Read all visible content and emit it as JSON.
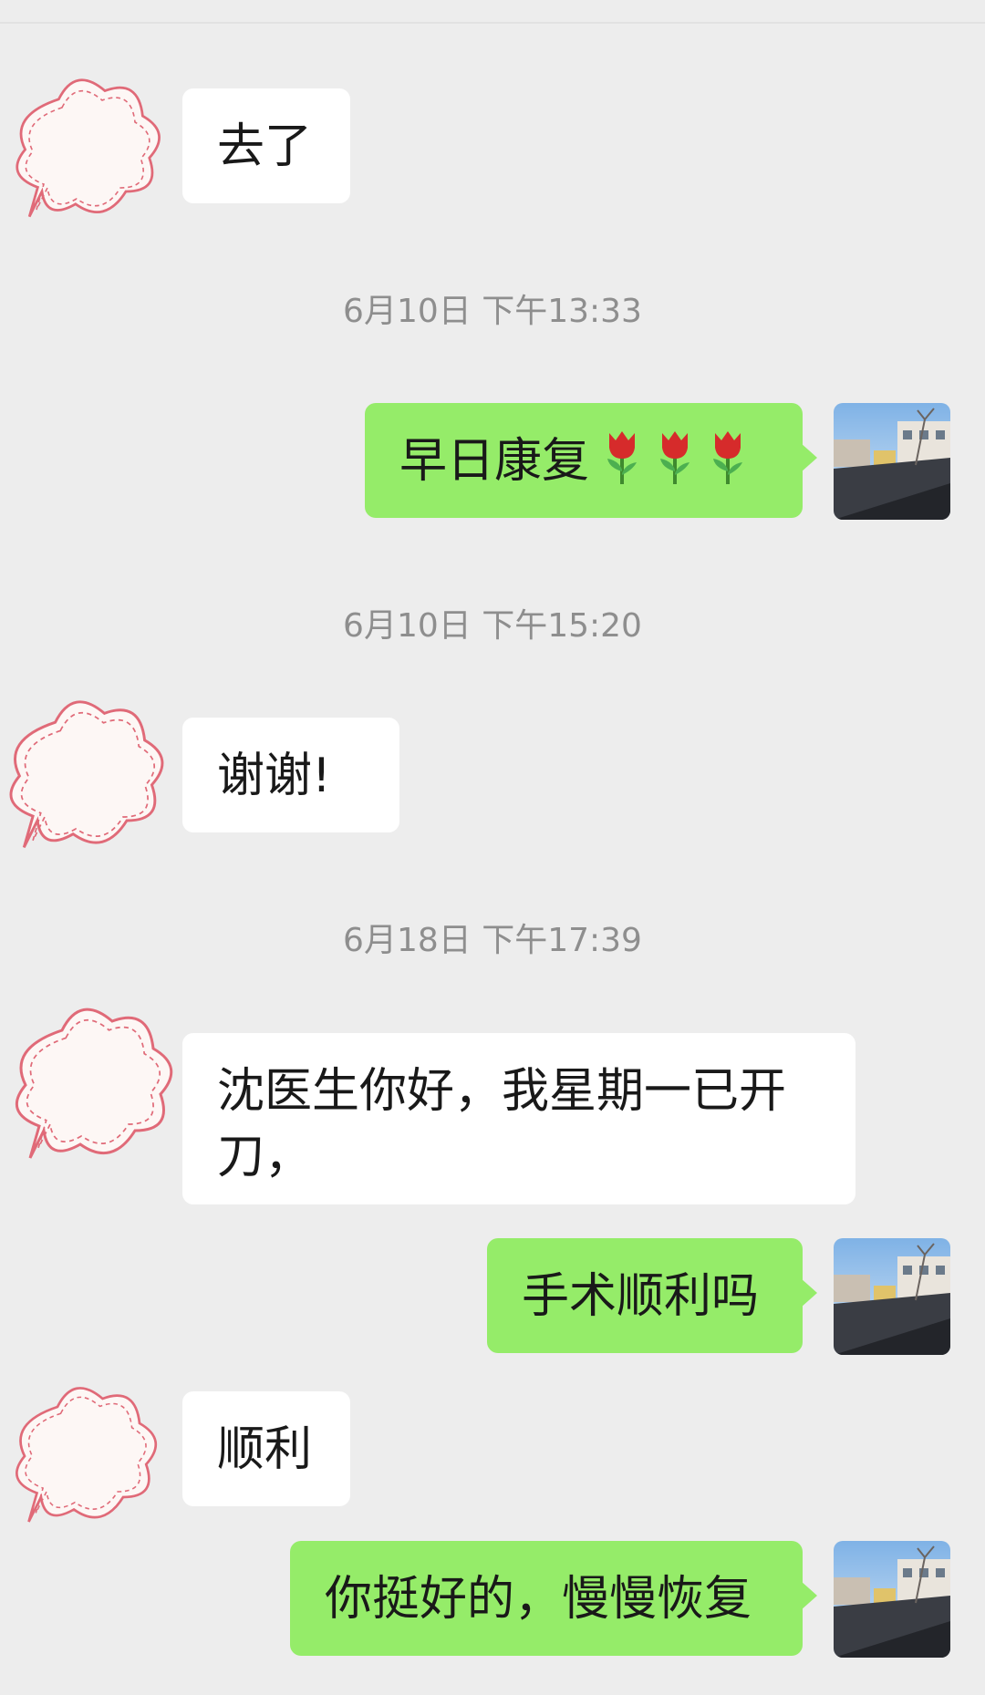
{
  "messages": [
    {
      "type": "incoming",
      "text": "去了"
    },
    {
      "type": "timestamp",
      "text": "6月10日 下午13:33"
    },
    {
      "type": "outgoing",
      "text": "早日康复",
      "emoji": "tulip-icon",
      "emoji_count": 3
    },
    {
      "type": "timestamp",
      "text": "6月10日 下午15:20"
    },
    {
      "type": "incoming",
      "text": "谢谢!"
    },
    {
      "type": "timestamp",
      "text": "6月18日 下午17:39"
    },
    {
      "type": "incoming",
      "text": "沈医生你好，我星期一已开刀，"
    },
    {
      "type": "outgoing",
      "text": "手术顺利吗"
    },
    {
      "type": "incoming",
      "text": "顺利"
    },
    {
      "type": "outgoing",
      "text": "你挺好的，慢慢恢复"
    }
  ],
  "colors": {
    "background": "#ededed",
    "incoming_bubble": "#ffffff",
    "outgoing_bubble": "#95ec69",
    "timestamp_text": "#8e8e8e",
    "sticker_outline": "#e06a78"
  }
}
